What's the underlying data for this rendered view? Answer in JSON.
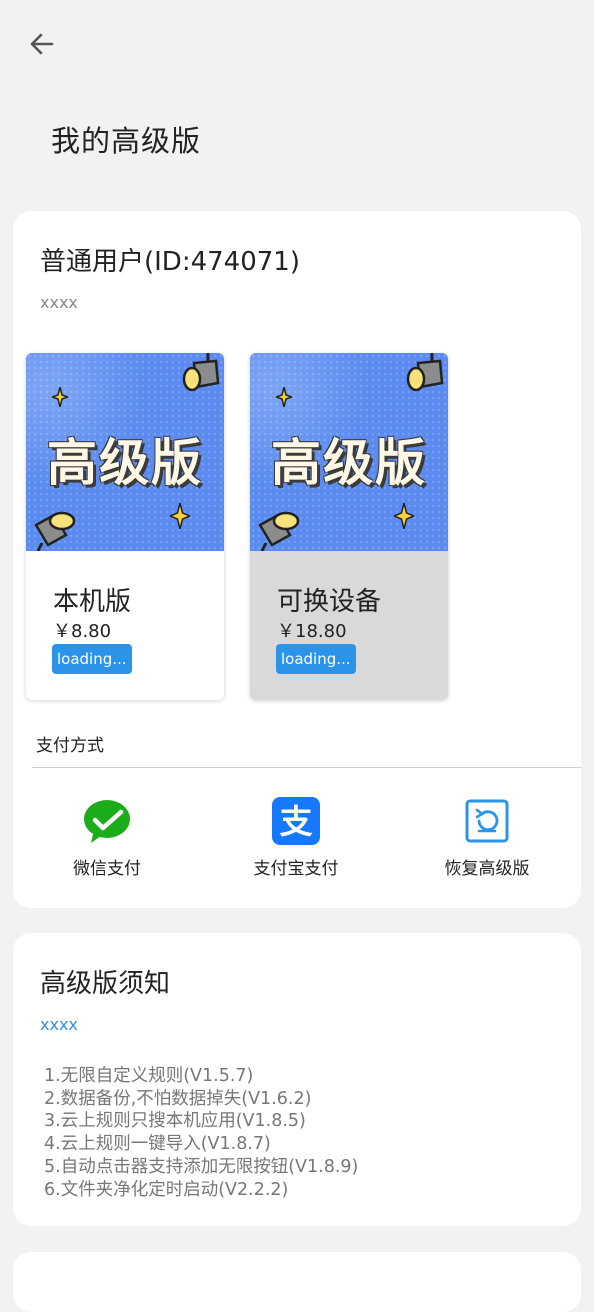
{
  "header": {
    "title": "我的高级版"
  },
  "user": {
    "status_line": "普通用户(ID:474071)",
    "subtitle": "xxxx"
  },
  "plans": [
    {
      "banner_text": "高级版",
      "name": "本机版",
      "price": "￥8.80",
      "status": "loading..."
    },
    {
      "banner_text": "高级版",
      "name": "可换设备",
      "price": "￥18.80",
      "status": "loading..."
    }
  ],
  "payment": {
    "label": "支付方式",
    "options": [
      {
        "label": "微信支付",
        "icon": "wechat-icon"
      },
      {
        "label": "支付宝支付",
        "icon": "alipay-icon"
      },
      {
        "label": "恢复高级版",
        "icon": "restore-icon"
      }
    ]
  },
  "notice": {
    "title": "高级版须知",
    "link": "xxxx",
    "features": [
      "1.无限自定义规则(V1.5.7)",
      "2.数据备份,不怕数据掉失(V1.6.2)",
      "3.云上规则只搜本机应用(V1.8.5)",
      "4.云上规则一键导入(V1.8.7)",
      "5.自动点击器支持添加无限按钮(V1.8.9)",
      "6.文件夹净化定时启动(V2.2.2)"
    ]
  },
  "colors": {
    "accent": "#2b93e8",
    "wechat": "#1aad19",
    "alipay": "#1677ff",
    "banner": "#5b8bf0"
  }
}
